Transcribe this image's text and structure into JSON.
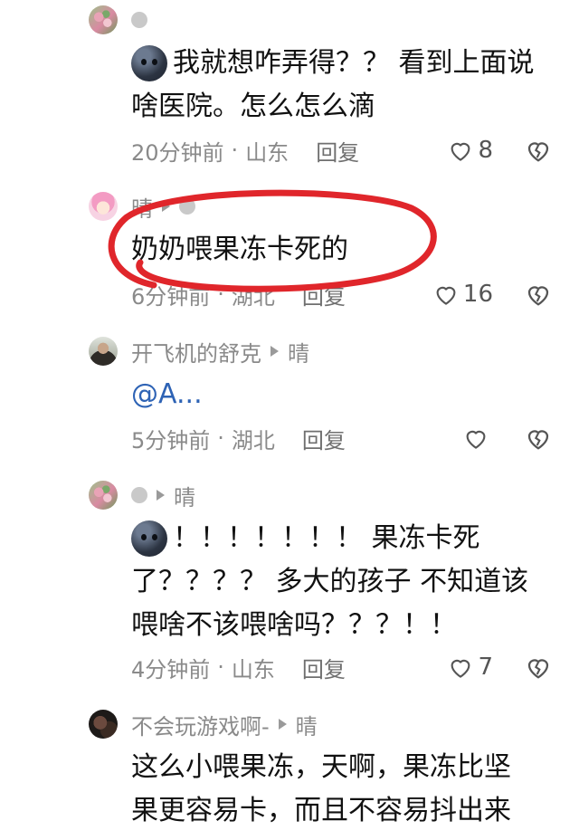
{
  "comments": [
    {
      "author": "",
      "reply_to": "",
      "lines": [
        "我就想咋弄得？？ 看到上面说",
        "啥医院。怎么怎么滴"
      ],
      "time": "20分钟前",
      "location": "山东",
      "reply_label": "回复",
      "likes": "8"
    },
    {
      "author": "晴",
      "reply_to": "",
      "lines": [
        "奶奶喂果冻卡死的"
      ],
      "time": "6分钟前",
      "location": "湖北",
      "reply_label": "回复",
      "likes": "16"
    },
    {
      "author": "开飞机的舒克",
      "reply_to": "晴",
      "lines": [
        "@A..."
      ],
      "time": "5分钟前",
      "location": "湖北",
      "reply_label": "回复",
      "likes": ""
    },
    {
      "author": "",
      "reply_to": "晴",
      "lines": [
        "！！！！！！！ 果冻卡死",
        "了？？？？ 多大的孩子  不知道该",
        "喂啥不该喂啥吗？？？！！"
      ],
      "time": "4分钟前",
      "location": "山东",
      "reply_label": "回复",
      "likes": "7"
    },
    {
      "author": "不会玩游戏啊-",
      "reply_to": "晴",
      "lines": [
        "这么小喂果冻，天啊，果冻比坚",
        "果更容易卡，而且不容易抖出来"
      ],
      "time": "",
      "location": "",
      "reply_label": "",
      "likes": ""
    }
  ],
  "separator": "·",
  "colors": {
    "highlight_circle": "#e0262b",
    "mention": "#2e63b5"
  },
  "icons": {
    "like": "heart-outline-icon",
    "dislike": "broken-heart-icon",
    "reply_arrow": "triangle-right-icon"
  }
}
